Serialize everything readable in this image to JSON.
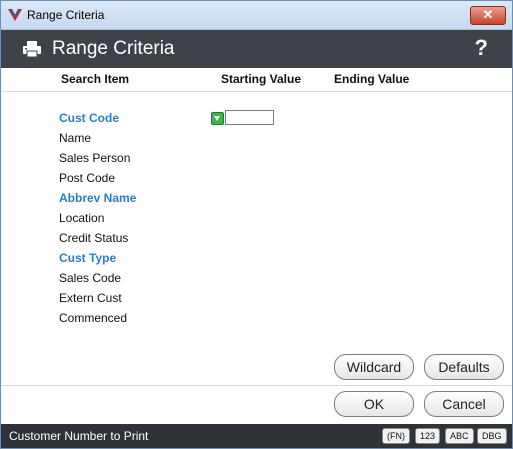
{
  "window": {
    "title": "Range Criteria",
    "close_label": "✕"
  },
  "header": {
    "title": "Range Criteria",
    "help_label": "?"
  },
  "columns": {
    "search_item": "Search Item",
    "starting_value": "Starting Value",
    "ending_value": "Ending Value"
  },
  "items": [
    {
      "label": "Cust Code",
      "highlight": true
    },
    {
      "label": "Name",
      "highlight": false
    },
    {
      "label": "Sales Person",
      "highlight": false
    },
    {
      "label": "Post Code",
      "highlight": false
    },
    {
      "label": "Abbrev Name",
      "highlight": true
    },
    {
      "label": "Location",
      "highlight": false
    },
    {
      "label": "Credit Status",
      "highlight": false
    },
    {
      "label": "Cust Type",
      "highlight": true
    },
    {
      "label": "Sales Code",
      "highlight": false
    },
    {
      "label": "Extern Cust",
      "highlight": false
    },
    {
      "label": "Commenced",
      "highlight": false
    }
  ],
  "starting_value": "",
  "buttons": {
    "wildcard": "Wildcard",
    "defaults": "Defaults",
    "ok": "OK",
    "cancel": "Cancel"
  },
  "status": {
    "text": "Customer Number to Print",
    "keys": [
      "(FN)",
      "123",
      "ABC",
      "DBG"
    ]
  },
  "colors": {
    "highlight": "#2a7fc1",
    "header_bg": "#3d4348",
    "status_bg": "#2f3337"
  }
}
